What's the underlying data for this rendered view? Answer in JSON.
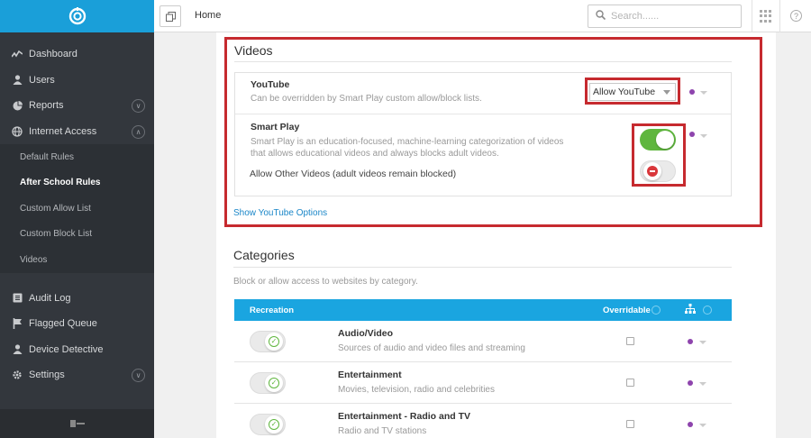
{
  "sidebar": {
    "logo_icon": "lifebuoy-icon",
    "items": [
      {
        "label": "Dashboard",
        "icon": "activity-icon"
      },
      {
        "label": "Users",
        "icon": "user-icon"
      },
      {
        "label": "Reports",
        "icon": "pie-chart-icon"
      },
      {
        "label": "Internet Access",
        "icon": "globe-icon"
      }
    ],
    "subitems": [
      {
        "label": "Default Rules"
      },
      {
        "label": "After School Rules",
        "active": true
      },
      {
        "label": "Custom Allow List"
      },
      {
        "label": "Custom Block List"
      },
      {
        "label": "Videos"
      }
    ],
    "items2": [
      {
        "label": "Audit Log",
        "icon": "list-icon"
      },
      {
        "label": "Flagged Queue",
        "icon": "flag-icon"
      },
      {
        "label": "Device Detective",
        "icon": "user-icon"
      },
      {
        "label": "Settings",
        "icon": "gear-icon"
      }
    ]
  },
  "topbar": {
    "breadcrumb": "Home",
    "search_placeholder": "Search......"
  },
  "videos": {
    "title": "Videos",
    "youtube_title": "YouTube",
    "youtube_desc": "Can be overridden by Smart Play custom allow/block lists.",
    "youtube_select": "Allow YouTube",
    "smartplay_title": "Smart Play",
    "smartplay_desc1": "Smart Play is an education-focused, machine-learning categorization of videos",
    "smartplay_desc2": "that allows educational videos and always blocks adult videos.",
    "smartplay_on": true,
    "allow_other_label": "Allow Other Videos (adult videos remain blocked)",
    "allow_other_on": false,
    "show_options_link": "Show YouTube Options",
    "accent": "#c62a2f",
    "dot_color": "#8e44ad"
  },
  "categories": {
    "title": "Categories",
    "description": "Block or allow access to websites by category.",
    "header_group": "Recreation",
    "header_overridable": "Overridable",
    "header_color": "#1aa5e0",
    "rows": [
      {
        "name": "Audio/Video",
        "desc": "Sources of audio and video files and streaming"
      },
      {
        "name": "Entertainment",
        "desc": "Movies, television, radio and celebrities"
      },
      {
        "name": "Entertainment - Radio and TV",
        "desc": "Radio and TV stations"
      }
    ]
  }
}
